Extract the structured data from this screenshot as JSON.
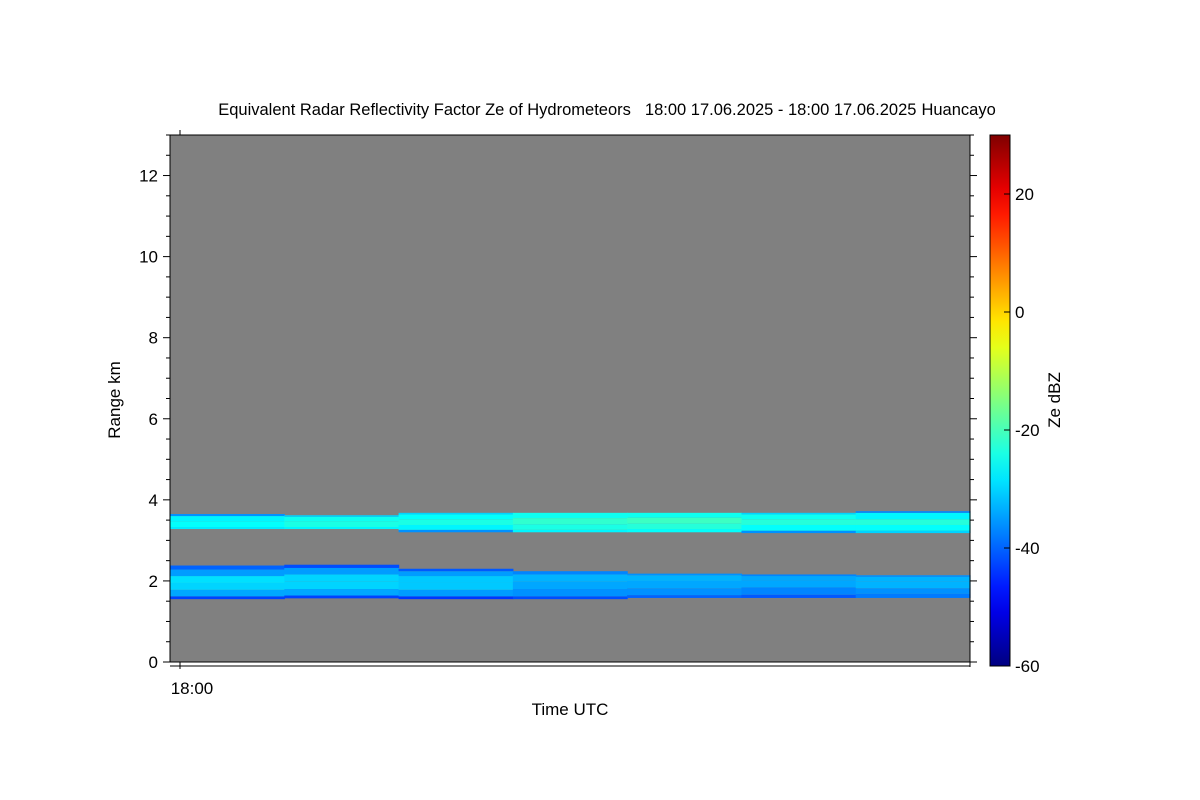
{
  "chart_data": {
    "type": "heatmap",
    "title": "Equivalent Radar Reflectivity Factor Ze of Hydrometeors",
    "time_range": "18:00 17.06.2025 - 18:00 17.06.2025",
    "location": "Huancayo",
    "xlabel": "Time UTC",
    "ylabel": "Range km",
    "colorbar_label": "Ze dBZ",
    "x_tick_labels": [
      "18:00"
    ],
    "y_ticks": [
      0,
      2,
      4,
      6,
      8,
      10,
      12
    ],
    "ylim": [
      0,
      13
    ],
    "colorbar_ticks": [
      -60,
      -40,
      -20,
      0,
      20
    ],
    "colorbar_range": [
      -60,
      30
    ],
    "colormap": "jet",
    "background_color": "#808080",
    "time_segments": 7,
    "layers": [
      {
        "name": "upper",
        "segments": [
          [
            [
              3.28,
              3.33,
              -28
            ],
            [
              3.33,
              3.47,
              -26
            ],
            [
              3.47,
              3.6,
              -27
            ],
            [
              3.6,
              3.65,
              -36
            ]
          ],
          [
            [
              3.28,
              3.33,
              -27
            ],
            [
              3.33,
              3.47,
              -24
            ],
            [
              3.47,
              3.58,
              -25
            ],
            [
              3.58,
              3.62,
              -30
            ]
          ],
          [
            [
              3.2,
              3.26,
              -36
            ],
            [
              3.26,
              3.38,
              -27
            ],
            [
              3.38,
              3.52,
              -24
            ],
            [
              3.52,
              3.64,
              -26
            ],
            [
              3.64,
              3.68,
              -30
            ]
          ],
          [
            [
              3.2,
              3.26,
              -27
            ],
            [
              3.26,
              3.4,
              -24
            ],
            [
              3.4,
              3.55,
              -22
            ],
            [
              3.55,
              3.68,
              -25
            ]
          ],
          [
            [
              3.2,
              3.28,
              -26
            ],
            [
              3.28,
              3.42,
              -23
            ],
            [
              3.42,
              3.56,
              -21
            ],
            [
              3.56,
              3.68,
              -25
            ]
          ],
          [
            [
              3.18,
              3.24,
              -36
            ],
            [
              3.24,
              3.38,
              -26
            ],
            [
              3.38,
              3.52,
              -23
            ],
            [
              3.52,
              3.64,
              -25
            ],
            [
              3.64,
              3.68,
              -30
            ]
          ],
          [
            [
              3.18,
              3.24,
              -30
            ],
            [
              3.24,
              3.38,
              -26
            ],
            [
              3.38,
              3.52,
              -23
            ],
            [
              3.52,
              3.68,
              -27
            ],
            [
              3.68,
              3.72,
              -37
            ]
          ]
        ]
      },
      {
        "name": "lower",
        "segments": [
          [
            [
              1.55,
              1.62,
              -43
            ],
            [
              1.62,
              1.78,
              -34
            ],
            [
              1.78,
              1.95,
              -30
            ],
            [
              1.95,
              2.12,
              -29
            ],
            [
              2.12,
              2.28,
              -35
            ],
            [
              2.28,
              2.38,
              -40
            ]
          ],
          [
            [
              1.57,
              1.64,
              -43
            ],
            [
              1.64,
              1.8,
              -34
            ],
            [
              1.8,
              1.98,
              -30
            ],
            [
              1.98,
              2.16,
              -30
            ],
            [
              2.16,
              2.32,
              -35
            ],
            [
              2.32,
              2.4,
              -42
            ]
          ],
          [
            [
              1.55,
              1.62,
              -44
            ],
            [
              1.62,
              1.78,
              -35
            ],
            [
              1.78,
              1.96,
              -31
            ],
            [
              1.96,
              2.12,
              -31
            ],
            [
              2.12,
              2.24,
              -35
            ],
            [
              2.24,
              2.3,
              -41
            ]
          ],
          [
            [
              1.55,
              1.62,
              -42
            ],
            [
              1.62,
              1.8,
              -36
            ],
            [
              1.8,
              1.98,
              -34
            ],
            [
              1.98,
              2.16,
              -33
            ],
            [
              2.16,
              2.24,
              -37
            ]
          ],
          [
            [
              1.58,
              1.65,
              -40
            ],
            [
              1.65,
              1.82,
              -36
            ],
            [
              1.82,
              2.0,
              -34
            ],
            [
              2.0,
              2.14,
              -33
            ],
            [
              2.14,
              2.18,
              -36
            ]
          ],
          [
            [
              1.58,
              1.66,
              -41
            ],
            [
              1.66,
              1.84,
              -37
            ],
            [
              1.84,
              2.02,
              -34
            ],
            [
              2.02,
              2.12,
              -34
            ],
            [
              2.12,
              2.16,
              -37
            ]
          ],
          [
            [
              1.58,
              1.68,
              -38
            ],
            [
              1.68,
              1.82,
              -36
            ],
            [
              1.82,
              1.98,
              -33
            ],
            [
              1.98,
              2.1,
              -33
            ],
            [
              2.1,
              2.14,
              -36
            ]
          ]
        ]
      }
    ]
  }
}
